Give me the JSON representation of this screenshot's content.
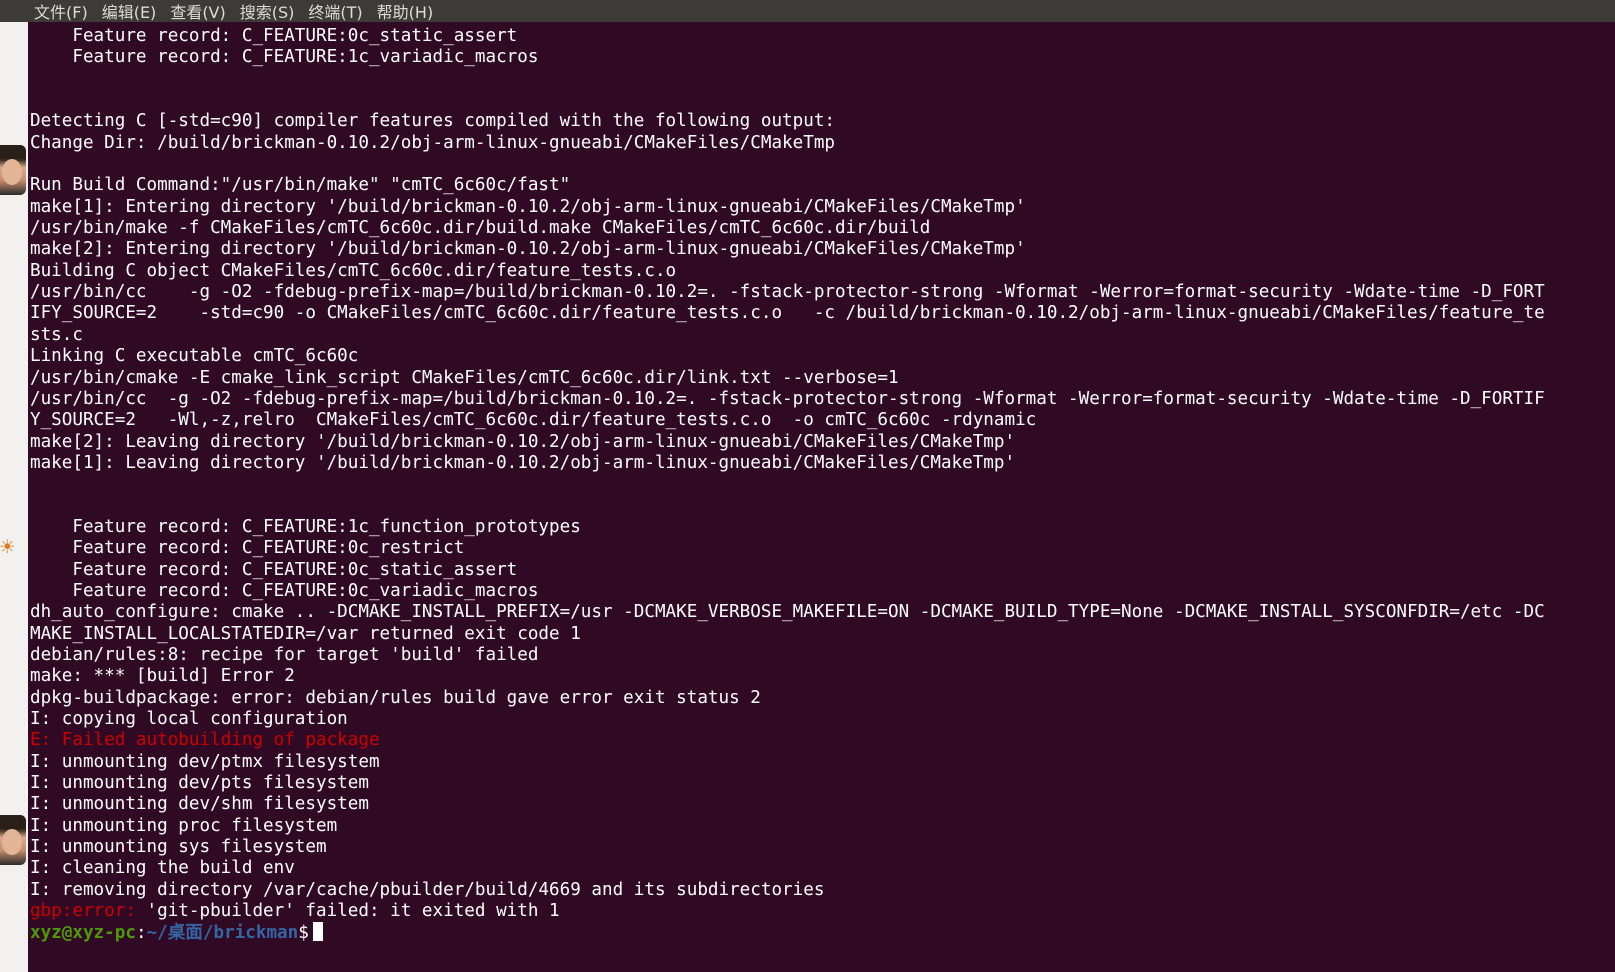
{
  "menu": [
    {
      "label": "文件(F)"
    },
    {
      "label": "编辑(E)"
    },
    {
      "label": "查看(V)"
    },
    {
      "label": "搜索(S)"
    },
    {
      "label": "终端(T)"
    },
    {
      "label": "帮助(H)"
    }
  ],
  "colors": {
    "background": "#300a24",
    "text": "#ffffff",
    "error": "#cc0000",
    "prompt_user": "#4e9a06",
    "prompt_path": "#3465a4"
  },
  "terminal": {
    "lines": [
      "    Feature record: C_FEATURE:0c_static_assert",
      "    Feature record: C_FEATURE:1c_variadic_macros",
      "",
      "",
      "Detecting C [-std=c90] compiler features compiled with the following output:",
      "Change Dir: /build/brickman-0.10.2/obj-arm-linux-gnueabi/CMakeFiles/CMakeTmp",
      "",
      "Run Build Command:\"/usr/bin/make\" \"cmTC_6c60c/fast\"",
      "make[1]: Entering directory '/build/brickman-0.10.2/obj-arm-linux-gnueabi/CMakeFiles/CMakeTmp'",
      "/usr/bin/make -f CMakeFiles/cmTC_6c60c.dir/build.make CMakeFiles/cmTC_6c60c.dir/build",
      "make[2]: Entering directory '/build/brickman-0.10.2/obj-arm-linux-gnueabi/CMakeFiles/CMakeTmp'",
      "Building C object CMakeFiles/cmTC_6c60c.dir/feature_tests.c.o",
      "/usr/bin/cc    -g -O2 -fdebug-prefix-map=/build/brickman-0.10.2=. -fstack-protector-strong -Wformat -Werror=format-security -Wdate-time -D_FORT",
      "IFY_SOURCE=2    -std=c90 -o CMakeFiles/cmTC_6c60c.dir/feature_tests.c.o   -c /build/brickman-0.10.2/obj-arm-linux-gnueabi/CMakeFiles/feature_te",
      "sts.c",
      "Linking C executable cmTC_6c60c",
      "/usr/bin/cmake -E cmake_link_script CMakeFiles/cmTC_6c60c.dir/link.txt --verbose=1",
      "/usr/bin/cc  -g -O2 -fdebug-prefix-map=/build/brickman-0.10.2=. -fstack-protector-strong -Wformat -Werror=format-security -Wdate-time -D_FORTIF",
      "Y_SOURCE=2   -Wl,-z,relro  CMakeFiles/cmTC_6c60c.dir/feature_tests.c.o  -o cmTC_6c60c -rdynamic",
      "make[2]: Leaving directory '/build/brickman-0.10.2/obj-arm-linux-gnueabi/CMakeFiles/CMakeTmp'",
      "make[1]: Leaving directory '/build/brickman-0.10.2/obj-arm-linux-gnueabi/CMakeFiles/CMakeTmp'",
      "",
      "",
      "    Feature record: C_FEATURE:1c_function_prototypes",
      "    Feature record: C_FEATURE:0c_restrict",
      "    Feature record: C_FEATURE:0c_static_assert",
      "    Feature record: C_FEATURE:0c_variadic_macros",
      "dh_auto_configure: cmake .. -DCMAKE_INSTALL_PREFIX=/usr -DCMAKE_VERBOSE_MAKEFILE=ON -DCMAKE_BUILD_TYPE=None -DCMAKE_INSTALL_SYSCONFDIR=/etc -DC",
      "MAKE_INSTALL_LOCALSTATEDIR=/var returned exit code 1",
      "debian/rules:8: recipe for target 'build' failed",
      "make: *** [build] Error 2",
      "dpkg-buildpackage: error: debian/rules build gave error exit status 2",
      "I: copying local configuration"
    ],
    "error_line": "E: Failed autobuilding of package",
    "tail_lines": [
      "I: unmounting dev/ptmx filesystem",
      "I: unmounting dev/pts filesystem",
      "I: unmounting dev/shm filesystem",
      "I: unmounting proc filesystem",
      "I: unmounting sys filesystem",
      "I: cleaning the build env",
      "I: removing directory /var/cache/pbuilder/build/4669 and its subdirectories"
    ],
    "gbp_error_prefix": "gbp:error:",
    "gbp_error_message": " 'git-pbuilder' failed: it exited with 1",
    "prompt": {
      "user_host": "xyz@xyz-pc",
      "separator": ":",
      "path": "~/桌面/brickman",
      "symbol": "$"
    }
  }
}
